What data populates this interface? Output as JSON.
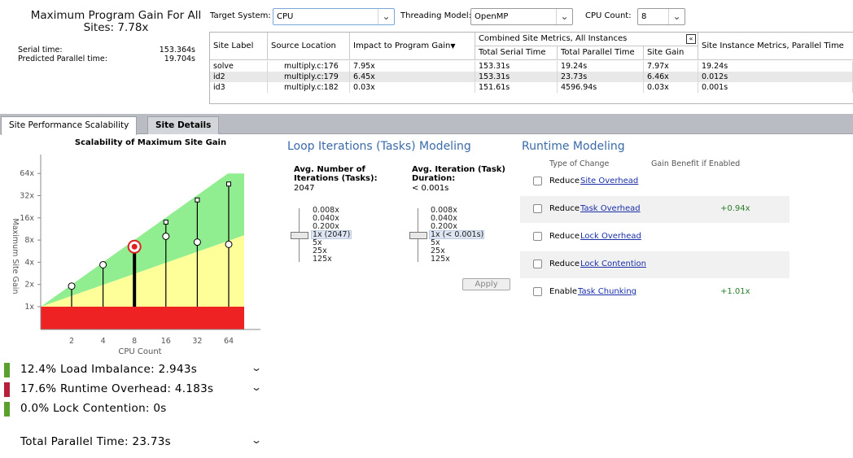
{
  "summary": {
    "title": "Maximum Program Gain For All Sites: 7.78x",
    "serial_label": "Serial time:",
    "serial_value": "153.364s",
    "parallel_label": "Predicted Parallel time:",
    "parallel_value": "19.704s"
  },
  "selectors": {
    "target_label": "Target System:",
    "target_value": "CPU",
    "threading_label": "Threading Model:",
    "threading_value": "OpenMP",
    "cpu_label": "CPU Count:",
    "cpu_value": "8"
  },
  "grid": {
    "headers": {
      "site_label": "Site Label",
      "source": "Source Location",
      "impact": "Impact to Program Gain",
      "combined": "Combined Site Metrics, All Instances",
      "total_serial": "Total Serial Time",
      "total_parallel": "Total Parallel Time",
      "site_gain": "Site Gain",
      "instance": "Site Instance Metrics, Parallel Time"
    },
    "rows": [
      {
        "label": "solve",
        "source": "multiply.c:176",
        "impact": "7.95x",
        "serial": "153.31s",
        "parallel": "19.24s",
        "gain": "7.97x",
        "instance": "19.24s"
      },
      {
        "label": "id2",
        "source": "multiply.c:179",
        "impact": "6.45x",
        "serial": "153.31s",
        "parallel": "23.73s",
        "gain": "6.46x",
        "instance": "0.012s"
      },
      {
        "label": "id3",
        "source": "multiply.c:182",
        "impact": "0.03x",
        "serial": "151.61s",
        "parallel": "4596.94s",
        "gain": "0.03x",
        "instance": "0.001s"
      }
    ]
  },
  "tabs": [
    "Site Performance Scalability",
    "Site Details"
  ],
  "chart_data": {
    "type": "scatter",
    "title": "Scalability of Maximum Site Gain",
    "xlabel": "CPU Count",
    "ylabel": "Maximum Site Gain",
    "x_ticks": [
      "2",
      "4",
      "8",
      "16",
      "32",
      "64"
    ],
    "y_ticks": [
      "1x",
      "2x",
      "4x",
      "8x",
      "16x",
      "32x",
      "64x"
    ],
    "log_scale": true,
    "series": [
      {
        "name": "",
        "x": [
          2,
          4,
          8,
          16,
          32,
          64
        ],
        "values": [
          1.9,
          3.7,
          6.5,
          9.0,
          7.5,
          7.0
        ]
      }
    ],
    "upper_bound": [
      2,
      4,
      8,
      14,
      28,
      46
    ],
    "selected_x": 8
  },
  "loop_modeling": {
    "title": "Loop Iterations (Tasks) Modeling",
    "avg_iter_label": "Avg. Number of Iterations (Tasks):",
    "avg_iter_value": "2047",
    "avg_dur_label": "Avg. Iteration (Task) Duration:",
    "avg_dur_value": "< 0.001s",
    "iter_options": [
      "0.008x",
      "0.040x",
      "0.200x",
      "1x (2047)",
      "5x",
      "25x",
      "125x"
    ],
    "dur_options": [
      "0.008x",
      "0.040x",
      "0.200x",
      "1x (< 0.001s)",
      "5x",
      "25x",
      "125x"
    ],
    "apply_label": "Apply"
  },
  "runtime_modeling": {
    "title": "Runtime Modeling",
    "col_type": "Type of Change",
    "col_gain": "Gain Benefit if Enabled",
    "rows": [
      {
        "verb": "Reduce",
        "link": "Site Overhead",
        "gain": ""
      },
      {
        "verb": "Reduce",
        "link": "Task Overhead",
        "gain": "+0.94x"
      },
      {
        "verb": "Reduce",
        "link": "Lock Overhead",
        "gain": ""
      },
      {
        "verb": "Reduce",
        "link": "Lock Contention",
        "gain": ""
      },
      {
        "verb": "Enable",
        "link": "Task Chunking",
        "gain": "+1.01x"
      }
    ]
  },
  "metrics": [
    {
      "text": "12.4% Load Imbalance: 2.943s",
      "color": "#5aa02c",
      "expand": true
    },
    {
      "text": "17.6% Runtime Overhead: 4.183s",
      "color": "#b8203a",
      "expand": true
    },
    {
      "text": "0.0% Lock Contention: 0s",
      "color": "#5aa02c",
      "expand": false
    }
  ],
  "total": {
    "text": "Total Parallel Time: 23.73s"
  },
  "colors": {
    "accent": "#3a6aa8",
    "green_zone": "#90ee90",
    "yellow_zone": "#ffff99",
    "red_zone": "#ee2222"
  }
}
